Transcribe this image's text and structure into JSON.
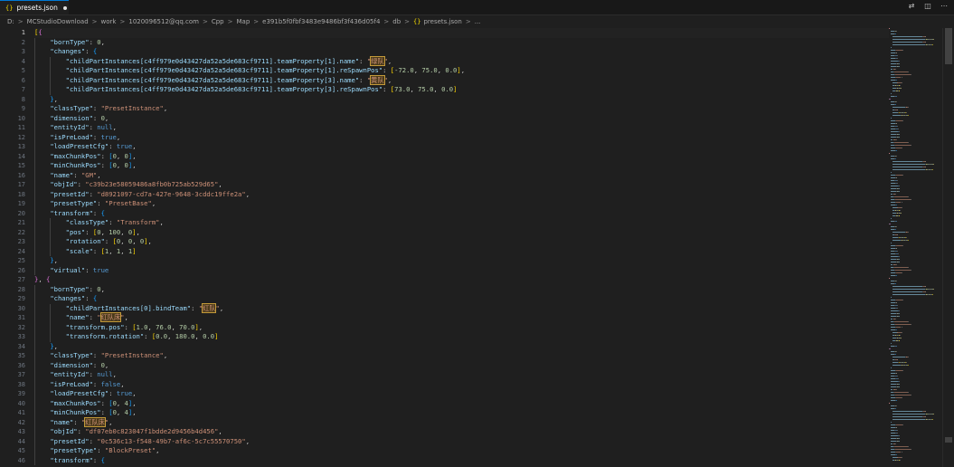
{
  "tab": {
    "braces": "{}",
    "filename": "presets.json"
  },
  "breadcrumb": [
    "D:",
    "MCStudioDownload",
    "work",
    "1020096512@qq.com",
    "Cpp",
    "Map",
    "e391b5f0fbf3483e9486bf3f436d05f4",
    "db",
    "presets.json",
    "..."
  ],
  "breadcrumb_braces": "{}",
  "lines": [
    [
      [
        "b1",
        "["
      ],
      [
        "b2",
        "{"
      ]
    ],
    [
      [
        "g1",
        ""
      ],
      [
        "k",
        "\"bornType\""
      ],
      [
        "p",
        ": "
      ],
      [
        "n",
        "0"
      ],
      [
        "p",
        ","
      ]
    ],
    [
      [
        "g1",
        ""
      ],
      [
        "k",
        "\"changes\""
      ],
      [
        "p",
        ": "
      ],
      [
        "b3",
        "{"
      ]
    ],
    [
      [
        "g2",
        ""
      ],
      [
        "k",
        "\"childPartInstances[c4ff979e0d43427da52a5de683cf9711].teamProperty[1].name\""
      ],
      [
        "p",
        ": "
      ],
      [
        "s",
        "\""
      ],
      [
        "shl",
        "绿队"
      ],
      [
        "s",
        "\""
      ],
      [
        "p",
        ","
      ]
    ],
    [
      [
        "g2",
        ""
      ],
      [
        "k",
        "\"childPartInstances[c4ff979e0d43427da52a5de683cf9711].teamProperty[1].reSpawnPos\""
      ],
      [
        "p",
        ": "
      ],
      [
        "b1",
        "["
      ],
      [
        "n",
        "-72.0"
      ],
      [
        "p",
        ", "
      ],
      [
        "n",
        "75.0"
      ],
      [
        "p",
        ", "
      ],
      [
        "n",
        "0.0"
      ],
      [
        "b1",
        "]"
      ],
      [
        "p",
        ","
      ]
    ],
    [
      [
        "g2",
        ""
      ],
      [
        "k",
        "\"childPartInstances[c4ff979e0d43427da52a5de683cf9711].teamProperty[3].name\""
      ],
      [
        "p",
        ": "
      ],
      [
        "s",
        "\""
      ],
      [
        "shl",
        "黄队"
      ],
      [
        "s",
        "\""
      ],
      [
        "p",
        ","
      ]
    ],
    [
      [
        "g2",
        ""
      ],
      [
        "k",
        "\"childPartInstances[c4ff979e0d43427da52a5de683cf9711].teamProperty[3].reSpawnPos\""
      ],
      [
        "p",
        ": "
      ],
      [
        "b1",
        "["
      ],
      [
        "n",
        "73.0"
      ],
      [
        "p",
        ", "
      ],
      [
        "n",
        "75.0"
      ],
      [
        "p",
        ", "
      ],
      [
        "n",
        "0.0"
      ],
      [
        "b1",
        "]"
      ]
    ],
    [
      [
        "g1",
        ""
      ],
      [
        "b3",
        "}"
      ],
      [
        "p",
        ","
      ]
    ],
    [
      [
        "g1",
        ""
      ],
      [
        "k",
        "\"classType\""
      ],
      [
        "p",
        ": "
      ],
      [
        "s",
        "\"PresetInstance\""
      ],
      [
        "p",
        ","
      ]
    ],
    [
      [
        "g1",
        ""
      ],
      [
        "k",
        "\"dimension\""
      ],
      [
        "p",
        ": "
      ],
      [
        "n",
        "0"
      ],
      [
        "p",
        ","
      ]
    ],
    [
      [
        "g1",
        ""
      ],
      [
        "k",
        "\"entityId\""
      ],
      [
        "p",
        ": "
      ],
      [
        "kw",
        "null"
      ],
      [
        "p",
        ","
      ]
    ],
    [
      [
        "g1",
        ""
      ],
      [
        "k",
        "\"isPreLoad\""
      ],
      [
        "p",
        ": "
      ],
      [
        "kw",
        "true"
      ],
      [
        "p",
        ","
      ]
    ],
    [
      [
        "g1",
        ""
      ],
      [
        "k",
        "\"loadPresetCfg\""
      ],
      [
        "p",
        ": "
      ],
      [
        "kw",
        "true"
      ],
      [
        "p",
        ","
      ]
    ],
    [
      [
        "g1",
        ""
      ],
      [
        "k",
        "\"maxChunkPos\""
      ],
      [
        "p",
        ": "
      ],
      [
        "b3",
        "["
      ],
      [
        "n",
        "0"
      ],
      [
        "p",
        ", "
      ],
      [
        "n",
        "0"
      ],
      [
        "b3",
        "]"
      ],
      [
        "p",
        ","
      ]
    ],
    [
      [
        "g1",
        ""
      ],
      [
        "k",
        "\"minChunkPos\""
      ],
      [
        "p",
        ": "
      ],
      [
        "b3",
        "["
      ],
      [
        "n",
        "0"
      ],
      [
        "p",
        ", "
      ],
      [
        "n",
        "0"
      ],
      [
        "b3",
        "]"
      ],
      [
        "p",
        ","
      ]
    ],
    [
      [
        "g1",
        ""
      ],
      [
        "k",
        "\"name\""
      ],
      [
        "p",
        ": "
      ],
      [
        "s",
        "\"GM\""
      ],
      [
        "p",
        ","
      ]
    ],
    [
      [
        "g1",
        ""
      ],
      [
        "k",
        "\"objId\""
      ],
      [
        "p",
        ": "
      ],
      [
        "s",
        "\"c39b23e58059486a8fb0b725ab529d65\""
      ],
      [
        "p",
        ","
      ]
    ],
    [
      [
        "g1",
        ""
      ],
      [
        "k",
        "\"presetId\""
      ],
      [
        "p",
        ": "
      ],
      [
        "s",
        "\"d8921097-cd7a-427e-9648-3cddc19ffe2a\""
      ],
      [
        "p",
        ","
      ]
    ],
    [
      [
        "g1",
        ""
      ],
      [
        "k",
        "\"presetType\""
      ],
      [
        "p",
        ": "
      ],
      [
        "s",
        "\"PresetBase\""
      ],
      [
        "p",
        ","
      ]
    ],
    [
      [
        "g1",
        ""
      ],
      [
        "k",
        "\"transform\""
      ],
      [
        "p",
        ": "
      ],
      [
        "b3",
        "{"
      ]
    ],
    [
      [
        "g2",
        ""
      ],
      [
        "k",
        "\"classType\""
      ],
      [
        "p",
        ": "
      ],
      [
        "s",
        "\"Transform\""
      ],
      [
        "p",
        ","
      ]
    ],
    [
      [
        "g2",
        ""
      ],
      [
        "k",
        "\"pos\""
      ],
      [
        "p",
        ": "
      ],
      [
        "b1",
        "["
      ],
      [
        "n",
        "0"
      ],
      [
        "p",
        ", "
      ],
      [
        "n",
        "100"
      ],
      [
        "p",
        ", "
      ],
      [
        "n",
        "0"
      ],
      [
        "b1",
        "]"
      ],
      [
        "p",
        ","
      ]
    ],
    [
      [
        "g2",
        ""
      ],
      [
        "k",
        "\"rotation\""
      ],
      [
        "p",
        ": "
      ],
      [
        "b1",
        "["
      ],
      [
        "n",
        "0"
      ],
      [
        "p",
        ", "
      ],
      [
        "n",
        "0"
      ],
      [
        "p",
        ", "
      ],
      [
        "n",
        "0"
      ],
      [
        "b1",
        "]"
      ],
      [
        "p",
        ","
      ]
    ],
    [
      [
        "g2",
        ""
      ],
      [
        "k",
        "\"scale\""
      ],
      [
        "p",
        ": "
      ],
      [
        "b1",
        "["
      ],
      [
        "n",
        "1"
      ],
      [
        "p",
        ", "
      ],
      [
        "n",
        "1"
      ],
      [
        "p",
        ", "
      ],
      [
        "n",
        "1"
      ],
      [
        "b1",
        "]"
      ]
    ],
    [
      [
        "g1",
        ""
      ],
      [
        "b3",
        "}"
      ],
      [
        "p",
        ","
      ]
    ],
    [
      [
        "g1",
        ""
      ],
      [
        "k",
        "\"virtual\""
      ],
      [
        "p",
        ": "
      ],
      [
        "kw",
        "true"
      ]
    ],
    [
      [
        "b2",
        "}"
      ],
      [
        "p",
        ", "
      ],
      [
        "b2",
        "{"
      ]
    ],
    [
      [
        "g1",
        ""
      ],
      [
        "k",
        "\"bornType\""
      ],
      [
        "p",
        ": "
      ],
      [
        "n",
        "0"
      ],
      [
        "p",
        ","
      ]
    ],
    [
      [
        "g1",
        ""
      ],
      [
        "k",
        "\"changes\""
      ],
      [
        "p",
        ": "
      ],
      [
        "b3",
        "{"
      ]
    ],
    [
      [
        "g2",
        ""
      ],
      [
        "k",
        "\"childPartInstances[0].bindTeam\""
      ],
      [
        "p",
        ": "
      ],
      [
        "s",
        "\""
      ],
      [
        "shl",
        "红队"
      ],
      [
        "s",
        "\""
      ],
      [
        "p",
        ","
      ]
    ],
    [
      [
        "g2",
        ""
      ],
      [
        "k",
        "\"name\""
      ],
      [
        "p",
        ": "
      ],
      [
        "s",
        "\""
      ],
      [
        "shl",
        "红队床"
      ],
      [
        "s",
        "\""
      ],
      [
        "p",
        ","
      ]
    ],
    [
      [
        "g2",
        ""
      ],
      [
        "k",
        "\"transform.pos\""
      ],
      [
        "p",
        ": "
      ],
      [
        "b1",
        "["
      ],
      [
        "n",
        "1.0"
      ],
      [
        "p",
        ", "
      ],
      [
        "n",
        "76.0"
      ],
      [
        "p",
        ", "
      ],
      [
        "n",
        "70.0"
      ],
      [
        "b1",
        "]"
      ],
      [
        "p",
        ","
      ]
    ],
    [
      [
        "g2",
        ""
      ],
      [
        "k",
        "\"transform.rotation\""
      ],
      [
        "p",
        ": "
      ],
      [
        "b1",
        "["
      ],
      [
        "n",
        "0.0"
      ],
      [
        "p",
        ", "
      ],
      [
        "n",
        "180.0"
      ],
      [
        "p",
        ", "
      ],
      [
        "n",
        "0.0"
      ],
      [
        "b1",
        "]"
      ]
    ],
    [
      [
        "g1",
        ""
      ],
      [
        "b3",
        "}"
      ],
      [
        "p",
        ","
      ]
    ],
    [
      [
        "g1",
        ""
      ],
      [
        "k",
        "\"classType\""
      ],
      [
        "p",
        ": "
      ],
      [
        "s",
        "\"PresetInstance\""
      ],
      [
        "p",
        ","
      ]
    ],
    [
      [
        "g1",
        ""
      ],
      [
        "k",
        "\"dimension\""
      ],
      [
        "p",
        ": "
      ],
      [
        "n",
        "0"
      ],
      [
        "p",
        ","
      ]
    ],
    [
      [
        "g1",
        ""
      ],
      [
        "k",
        "\"entityId\""
      ],
      [
        "p",
        ": "
      ],
      [
        "kw",
        "null"
      ],
      [
        "p",
        ","
      ]
    ],
    [
      [
        "g1",
        ""
      ],
      [
        "k",
        "\"isPreLoad\""
      ],
      [
        "p",
        ": "
      ],
      [
        "kw",
        "false"
      ],
      [
        "p",
        ","
      ]
    ],
    [
      [
        "g1",
        ""
      ],
      [
        "k",
        "\"loadPresetCfg\""
      ],
      [
        "p",
        ": "
      ],
      [
        "kw",
        "true"
      ],
      [
        "p",
        ","
      ]
    ],
    [
      [
        "g1",
        ""
      ],
      [
        "k",
        "\"maxChunkPos\""
      ],
      [
        "p",
        ": "
      ],
      [
        "b3",
        "["
      ],
      [
        "n",
        "0"
      ],
      [
        "p",
        ", "
      ],
      [
        "n",
        "4"
      ],
      [
        "b3",
        "]"
      ],
      [
        "p",
        ","
      ]
    ],
    [
      [
        "g1",
        ""
      ],
      [
        "k",
        "\"minChunkPos\""
      ],
      [
        "p",
        ": "
      ],
      [
        "b3",
        "["
      ],
      [
        "n",
        "0"
      ],
      [
        "p",
        ", "
      ],
      [
        "n",
        "4"
      ],
      [
        "b3",
        "]"
      ],
      [
        "p",
        ","
      ]
    ],
    [
      [
        "g1",
        ""
      ],
      [
        "k",
        "\"name\""
      ],
      [
        "p",
        ": "
      ],
      [
        "s",
        "\""
      ],
      [
        "shl",
        "红队床"
      ],
      [
        "s",
        "\""
      ],
      [
        "p",
        ","
      ]
    ],
    [
      [
        "g1",
        ""
      ],
      [
        "k",
        "\"objId\""
      ],
      [
        "p",
        ": "
      ],
      [
        "s",
        "\"df07eb0c823047f1bdde2d9456b4d456\""
      ],
      [
        "p",
        ","
      ]
    ],
    [
      [
        "g1",
        ""
      ],
      [
        "k",
        "\"presetId\""
      ],
      [
        "p",
        ": "
      ],
      [
        "s",
        "\"0c536c13-f548-49b7-af6c-5c7c55570750\""
      ],
      [
        "p",
        ","
      ]
    ],
    [
      [
        "g1",
        ""
      ],
      [
        "k",
        "\"presetType\""
      ],
      [
        "p",
        ": "
      ],
      [
        "s",
        "\"BlockPreset\""
      ],
      [
        "p",
        ","
      ]
    ],
    [
      [
        "g1",
        ""
      ],
      [
        "k",
        "\"transform\""
      ],
      [
        "p",
        ": "
      ],
      [
        "b3",
        "{"
      ]
    ]
  ],
  "colors": {
    "accent": "#0078d4",
    "background": "#1f1f1f",
    "key": "#9cdcfe",
    "string": "#ce9178",
    "number": "#b5cea8",
    "keyword": "#569cd6"
  },
  "icons": [
    "json-braces-icon",
    "split-editor-icon",
    "more-actions-icon"
  ]
}
